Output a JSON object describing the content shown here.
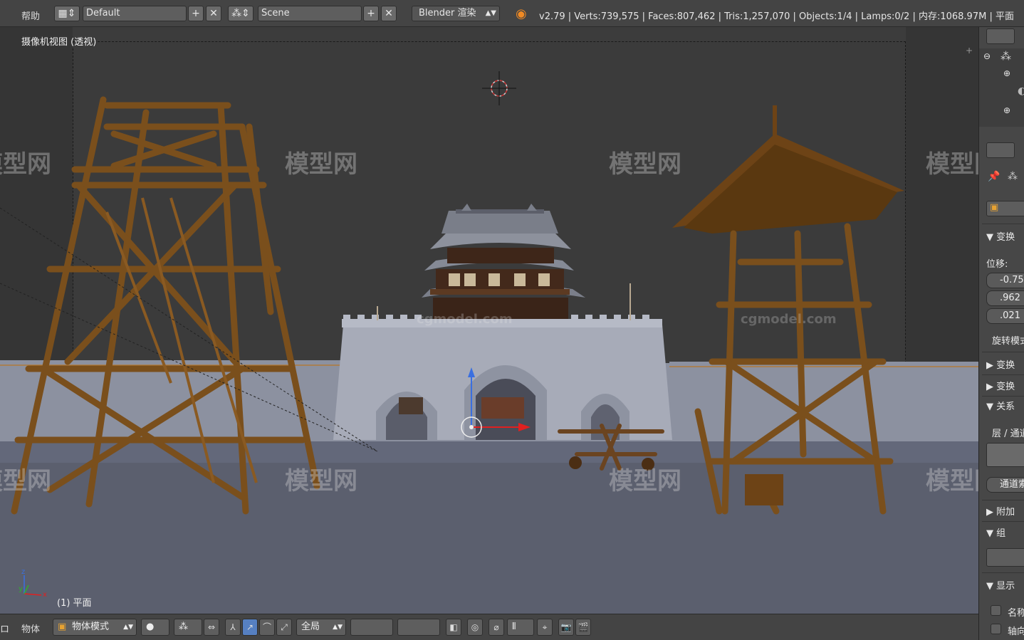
{
  "topbar": {
    "help_menu": "帮助",
    "screen_layout": "Default",
    "scene": "Scene",
    "render_engine": "Blender 渲染",
    "stats": "v2.79 | Verts:739,575 | Faces:807,462 | Tris:1,257,070 | Objects:1/4 | Lamps:0/2 | 内存:1068.97M | 平面"
  },
  "viewport": {
    "title": "摄像机视图 (透视)",
    "object_label": "(1) 平面",
    "watermark": "模型网",
    "watermark_url": "cgmodel.com"
  },
  "properties": {
    "transform_header": "▼ 变换",
    "location_label": "位移:",
    "loc_x": "-0.75",
    "loc_y": ".962",
    "loc_z": ".021",
    "rotation_mode": "旋转模式",
    "delta_transform": "▶ 变换",
    "transform_locks": "▶ 变换",
    "relations": "▼ 关系",
    "layers_label": "层 / 通道",
    "pass_index": "通道索",
    "parent_extra": "▶ 附加",
    "groups": "▼ 组",
    "display": "▼ 显示",
    "show_name": "名称",
    "show_axis": "轴向"
  },
  "bottombar": {
    "view_menu_tail": "ロ",
    "object_menu": "物体",
    "mode": "物体模式",
    "pivot_scope": "全局"
  },
  "colors": {
    "accent_blue": "#5680c2",
    "wood": "#7a4f1c",
    "wall": "#9a9fae",
    "ground": "#5b5f6e"
  }
}
